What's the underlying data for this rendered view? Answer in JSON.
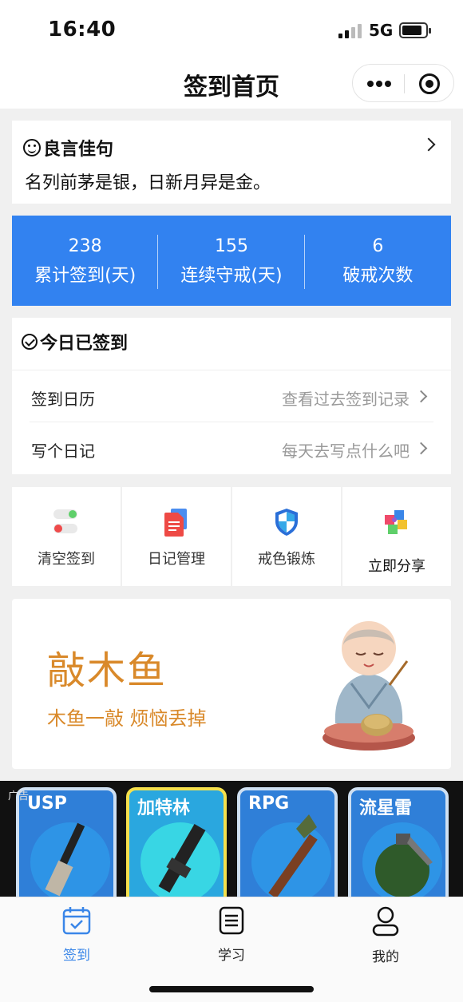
{
  "status": {
    "time": "16:40",
    "network": "5G"
  },
  "nav": {
    "title": "签到首页"
  },
  "quote": {
    "title": "良言佳句",
    "text": "名列前茅是银，日新月异是金。"
  },
  "stats": [
    {
      "value": "238",
      "label": "累计签到(天)"
    },
    {
      "value": "155",
      "label": "连续守戒(天)"
    },
    {
      "value": "6",
      "label": "破戒次数"
    }
  ],
  "sign": {
    "header": "今日已签到",
    "rows": [
      {
        "label": "签到日历",
        "hint": "查看过去签到记录"
      },
      {
        "label": "写个日记",
        "hint": "每天去写点什么吧"
      }
    ]
  },
  "tools": [
    {
      "label": "清空签到",
      "icon": "toggle-icon"
    },
    {
      "label": "日记管理",
      "icon": "document-icon"
    },
    {
      "label": "戒色锻炼",
      "icon": "shield-icon"
    },
    {
      "label": "立即分享",
      "icon": "puzzle-icon"
    }
  ],
  "banner": {
    "title": "敲木鱼",
    "subtitle": "木鱼一敲 烦恼丢掉"
  },
  "ad": {
    "tag": "广告",
    "items": [
      "USP",
      "加特林",
      "RPG",
      "流星雷"
    ]
  },
  "tabs": [
    {
      "label": "签到",
      "active": true,
      "icon": "calendar-check-icon"
    },
    {
      "label": "学习",
      "active": false,
      "icon": "notebook-icon"
    },
    {
      "label": "我的",
      "active": false,
      "icon": "user-icon"
    }
  ],
  "colors": {
    "accent": "#3282f0",
    "banner_text": "#d9892a",
    "tab_active": "#3a86e8"
  }
}
